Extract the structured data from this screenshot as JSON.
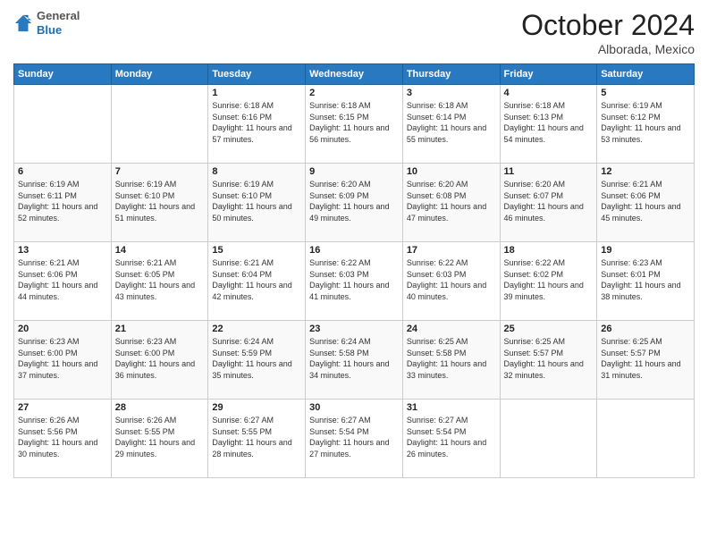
{
  "logo": {
    "general": "General",
    "blue": "Blue"
  },
  "title": "October 2024",
  "location": "Alborada, Mexico",
  "days_header": [
    "Sunday",
    "Monday",
    "Tuesday",
    "Wednesday",
    "Thursday",
    "Friday",
    "Saturday"
  ],
  "weeks": [
    [
      {
        "day": "",
        "sunrise": "",
        "sunset": "",
        "daylight": ""
      },
      {
        "day": "",
        "sunrise": "",
        "sunset": "",
        "daylight": ""
      },
      {
        "day": "1",
        "sunrise": "Sunrise: 6:18 AM",
        "sunset": "Sunset: 6:16 PM",
        "daylight": "Daylight: 11 hours and 57 minutes."
      },
      {
        "day": "2",
        "sunrise": "Sunrise: 6:18 AM",
        "sunset": "Sunset: 6:15 PM",
        "daylight": "Daylight: 11 hours and 56 minutes."
      },
      {
        "day": "3",
        "sunrise": "Sunrise: 6:18 AM",
        "sunset": "Sunset: 6:14 PM",
        "daylight": "Daylight: 11 hours and 55 minutes."
      },
      {
        "day": "4",
        "sunrise": "Sunrise: 6:18 AM",
        "sunset": "Sunset: 6:13 PM",
        "daylight": "Daylight: 11 hours and 54 minutes."
      },
      {
        "day": "5",
        "sunrise": "Sunrise: 6:19 AM",
        "sunset": "Sunset: 6:12 PM",
        "daylight": "Daylight: 11 hours and 53 minutes."
      }
    ],
    [
      {
        "day": "6",
        "sunrise": "Sunrise: 6:19 AM",
        "sunset": "Sunset: 6:11 PM",
        "daylight": "Daylight: 11 hours and 52 minutes."
      },
      {
        "day": "7",
        "sunrise": "Sunrise: 6:19 AM",
        "sunset": "Sunset: 6:10 PM",
        "daylight": "Daylight: 11 hours and 51 minutes."
      },
      {
        "day": "8",
        "sunrise": "Sunrise: 6:19 AM",
        "sunset": "Sunset: 6:10 PM",
        "daylight": "Daylight: 11 hours and 50 minutes."
      },
      {
        "day": "9",
        "sunrise": "Sunrise: 6:20 AM",
        "sunset": "Sunset: 6:09 PM",
        "daylight": "Daylight: 11 hours and 49 minutes."
      },
      {
        "day": "10",
        "sunrise": "Sunrise: 6:20 AM",
        "sunset": "Sunset: 6:08 PM",
        "daylight": "Daylight: 11 hours and 47 minutes."
      },
      {
        "day": "11",
        "sunrise": "Sunrise: 6:20 AM",
        "sunset": "Sunset: 6:07 PM",
        "daylight": "Daylight: 11 hours and 46 minutes."
      },
      {
        "day": "12",
        "sunrise": "Sunrise: 6:21 AM",
        "sunset": "Sunset: 6:06 PM",
        "daylight": "Daylight: 11 hours and 45 minutes."
      }
    ],
    [
      {
        "day": "13",
        "sunrise": "Sunrise: 6:21 AM",
        "sunset": "Sunset: 6:06 PM",
        "daylight": "Daylight: 11 hours and 44 minutes."
      },
      {
        "day": "14",
        "sunrise": "Sunrise: 6:21 AM",
        "sunset": "Sunset: 6:05 PM",
        "daylight": "Daylight: 11 hours and 43 minutes."
      },
      {
        "day": "15",
        "sunrise": "Sunrise: 6:21 AM",
        "sunset": "Sunset: 6:04 PM",
        "daylight": "Daylight: 11 hours and 42 minutes."
      },
      {
        "day": "16",
        "sunrise": "Sunrise: 6:22 AM",
        "sunset": "Sunset: 6:03 PM",
        "daylight": "Daylight: 11 hours and 41 minutes."
      },
      {
        "day": "17",
        "sunrise": "Sunrise: 6:22 AM",
        "sunset": "Sunset: 6:03 PM",
        "daylight": "Daylight: 11 hours and 40 minutes."
      },
      {
        "day": "18",
        "sunrise": "Sunrise: 6:22 AM",
        "sunset": "Sunset: 6:02 PM",
        "daylight": "Daylight: 11 hours and 39 minutes."
      },
      {
        "day": "19",
        "sunrise": "Sunrise: 6:23 AM",
        "sunset": "Sunset: 6:01 PM",
        "daylight": "Daylight: 11 hours and 38 minutes."
      }
    ],
    [
      {
        "day": "20",
        "sunrise": "Sunrise: 6:23 AM",
        "sunset": "Sunset: 6:00 PM",
        "daylight": "Daylight: 11 hours and 37 minutes."
      },
      {
        "day": "21",
        "sunrise": "Sunrise: 6:23 AM",
        "sunset": "Sunset: 6:00 PM",
        "daylight": "Daylight: 11 hours and 36 minutes."
      },
      {
        "day": "22",
        "sunrise": "Sunrise: 6:24 AM",
        "sunset": "Sunset: 5:59 PM",
        "daylight": "Daylight: 11 hours and 35 minutes."
      },
      {
        "day": "23",
        "sunrise": "Sunrise: 6:24 AM",
        "sunset": "Sunset: 5:58 PM",
        "daylight": "Daylight: 11 hours and 34 minutes."
      },
      {
        "day": "24",
        "sunrise": "Sunrise: 6:25 AM",
        "sunset": "Sunset: 5:58 PM",
        "daylight": "Daylight: 11 hours and 33 minutes."
      },
      {
        "day": "25",
        "sunrise": "Sunrise: 6:25 AM",
        "sunset": "Sunset: 5:57 PM",
        "daylight": "Daylight: 11 hours and 32 minutes."
      },
      {
        "day": "26",
        "sunrise": "Sunrise: 6:25 AM",
        "sunset": "Sunset: 5:57 PM",
        "daylight": "Daylight: 11 hours and 31 minutes."
      }
    ],
    [
      {
        "day": "27",
        "sunrise": "Sunrise: 6:26 AM",
        "sunset": "Sunset: 5:56 PM",
        "daylight": "Daylight: 11 hours and 30 minutes."
      },
      {
        "day": "28",
        "sunrise": "Sunrise: 6:26 AM",
        "sunset": "Sunset: 5:55 PM",
        "daylight": "Daylight: 11 hours and 29 minutes."
      },
      {
        "day": "29",
        "sunrise": "Sunrise: 6:27 AM",
        "sunset": "Sunset: 5:55 PM",
        "daylight": "Daylight: 11 hours and 28 minutes."
      },
      {
        "day": "30",
        "sunrise": "Sunrise: 6:27 AM",
        "sunset": "Sunset: 5:54 PM",
        "daylight": "Daylight: 11 hours and 27 minutes."
      },
      {
        "day": "31",
        "sunrise": "Sunrise: 6:27 AM",
        "sunset": "Sunset: 5:54 PM",
        "daylight": "Daylight: 11 hours and 26 minutes."
      },
      {
        "day": "",
        "sunrise": "",
        "sunset": "",
        "daylight": ""
      },
      {
        "day": "",
        "sunrise": "",
        "sunset": "",
        "daylight": ""
      }
    ]
  ]
}
